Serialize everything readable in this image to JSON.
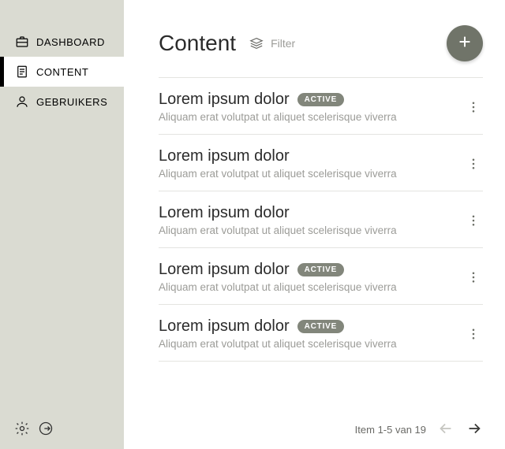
{
  "sidebar": {
    "items": [
      {
        "label": "DASHBOARD"
      },
      {
        "label": "CONTENT"
      },
      {
        "label": "GEBRUIKERS"
      }
    ]
  },
  "header": {
    "title": "Content",
    "filter_label": "Filter"
  },
  "rows": [
    {
      "title": "Lorem ipsum dolor",
      "badge": "ACTIVE",
      "sub": "Aliquam erat volutpat ut aliquet scelerisque viverra"
    },
    {
      "title": "Lorem ipsum dolor",
      "badge": "",
      "sub": "Aliquam erat volutpat ut aliquet scelerisque viverra"
    },
    {
      "title": "Lorem ipsum dolor",
      "badge": "",
      "sub": "Aliquam erat volutpat ut aliquet scelerisque viverra"
    },
    {
      "title": "Lorem ipsum dolor",
      "badge": "ACTIVE",
      "sub": "Aliquam erat volutpat ut aliquet scelerisque viverra"
    },
    {
      "title": "Lorem ipsum dolor",
      "badge": "ACTIVE",
      "sub": "Aliquam erat volutpat ut aliquet scelerisque viverra"
    }
  ],
  "pager": {
    "text": "Item 1-5 van 19"
  }
}
